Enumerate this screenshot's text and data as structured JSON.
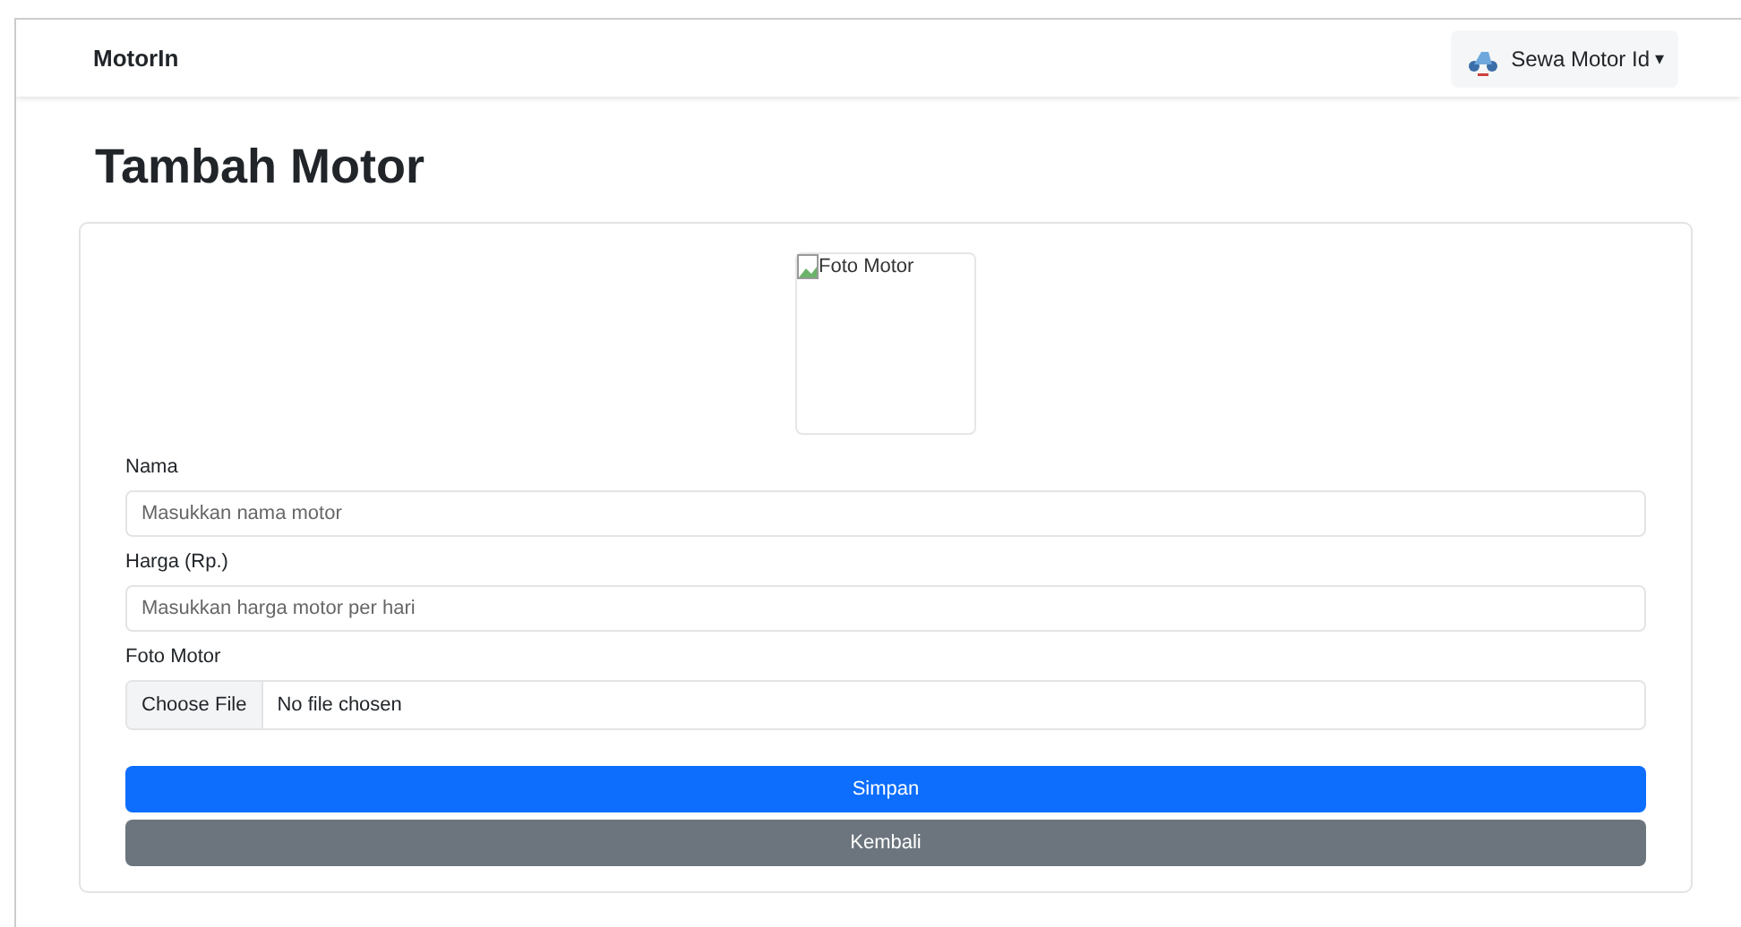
{
  "navbar": {
    "brand": "MotorIn",
    "user_menu": {
      "label": "Sewa Motor Id",
      "caret": "▾"
    }
  },
  "heading": "Tambah Motor",
  "form": {
    "preview": {
      "alt": "Foto Motor"
    },
    "fields": [
      {
        "kind": "text",
        "label": "Nama",
        "placeholder": "Masukkan nama motor"
      },
      {
        "kind": "text",
        "label": "Harga (Rp.)",
        "placeholder": "Masukkan harga motor per hari"
      },
      {
        "kind": "file",
        "label": "Foto Motor",
        "button": "Choose File",
        "status": "No file chosen"
      }
    ],
    "buttons": [
      {
        "label": "Simpan",
        "kind": "primary"
      },
      {
        "label": "Kembali",
        "kind": "secondary"
      }
    ]
  }
}
